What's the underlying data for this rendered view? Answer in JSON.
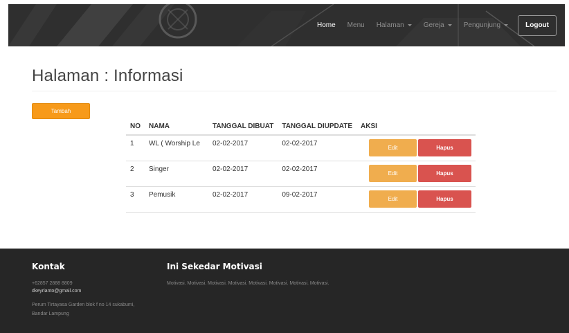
{
  "navbar": {
    "items": [
      {
        "label": "Home",
        "active": true
      },
      {
        "label": "Menu",
        "dropdown": false
      },
      {
        "label": "Halaman",
        "dropdown": true
      },
      {
        "label": "Gereja",
        "dropdown": true
      },
      {
        "label": "Pengunjung",
        "dropdown": true
      }
    ],
    "logout_label": "Logout"
  },
  "page": {
    "title": "Halaman : Informasi",
    "add_button_label": "Tambah"
  },
  "table": {
    "headers": [
      "NO",
      "NAMA",
      "TANGGAL DIBUAT",
      "TANGGAL DIUPDATE",
      "AKSI"
    ],
    "rows": [
      {
        "no": "1",
        "nama": "WL ( Worship Le",
        "dibuat": "02-02-2017",
        "diupdate": "02-02-2017"
      },
      {
        "no": "2",
        "nama": "Singer",
        "dibuat": "02-02-2017",
        "diupdate": "02-02-2017"
      },
      {
        "no": "3",
        "nama": "Pemusik",
        "dibuat": "02-02-2017",
        "diupdate": "09-02-2017"
      }
    ],
    "edit_label": "Edit",
    "delete_label": "Hapus"
  },
  "footer": {
    "contact_heading": "Kontak",
    "phone": "+62857 2888 8809",
    "email": "dkeyrianto@gmail.com",
    "address_line1": "Perum Tirtayasa Garden blok f no 14 sukabumi,",
    "address_line2": "Bandar Lampung",
    "motivation_heading": "Ini Sekedar Motivasi",
    "motivation_text": "Motivasi. Motivasi. Motivasi. Motivasi. Motivasi. Motivasi. Motivasi. Motivasi."
  },
  "colors": {
    "accent_orange": "#f79a1a",
    "edit_orange": "#f0ad4e",
    "delete_red": "#d9534f",
    "footer_bg": "#262626"
  },
  "icons": {
    "dropdown": "caret-down-icon"
  }
}
